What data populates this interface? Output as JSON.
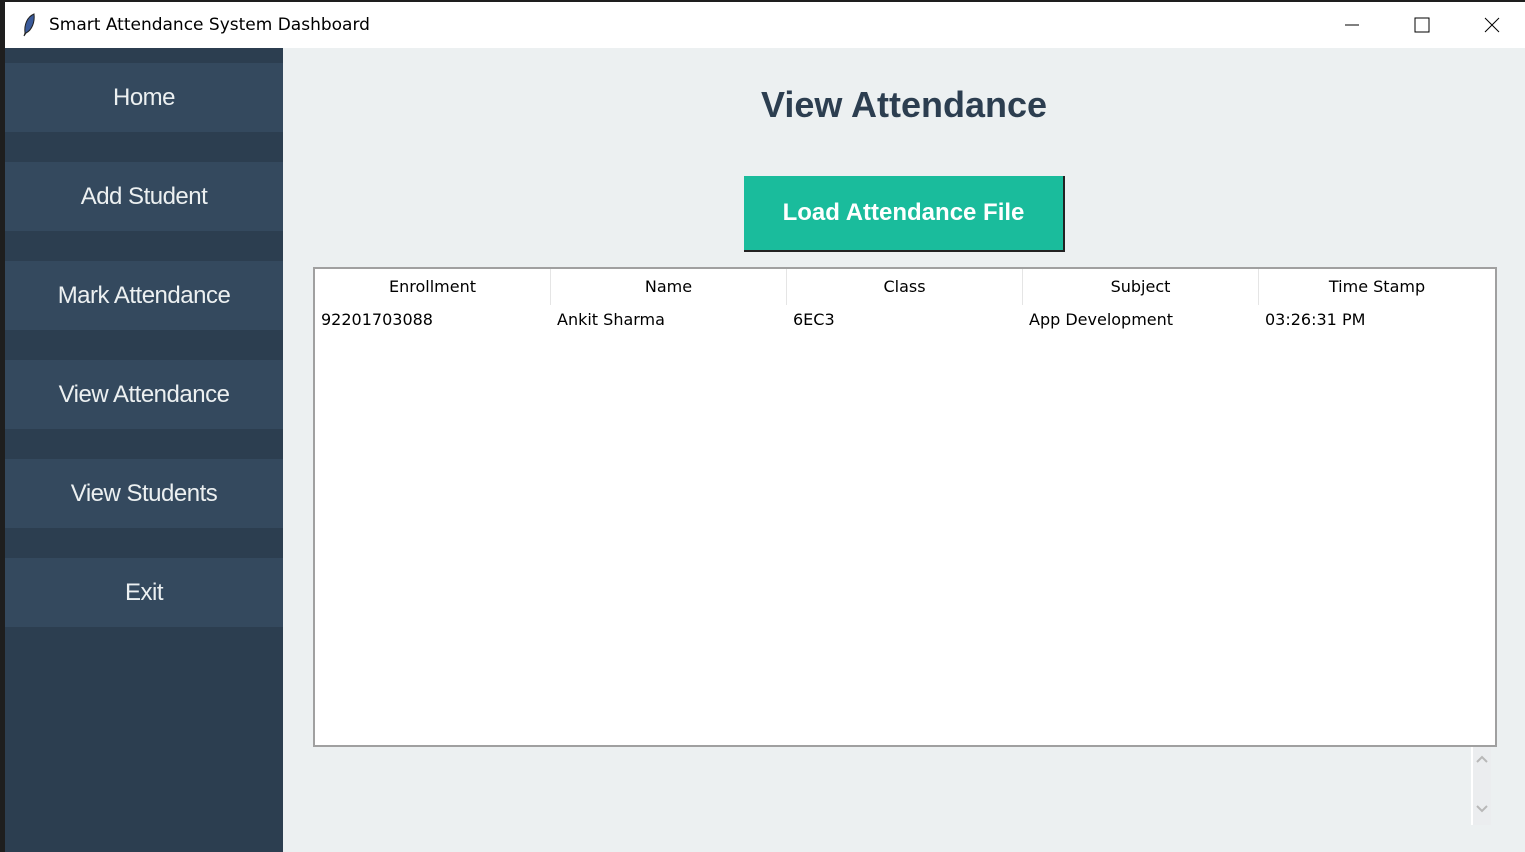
{
  "window": {
    "title": "Smart Attendance System Dashboard"
  },
  "sidebar": {
    "items": [
      {
        "label": "Home"
      },
      {
        "label": "Add Student"
      },
      {
        "label": "Mark Attendance"
      },
      {
        "label": "View Attendance"
      },
      {
        "label": "View Students"
      },
      {
        "label": "Exit"
      }
    ]
  },
  "main": {
    "heading": "View Attendance",
    "load_button": "Load Attendance File",
    "table": {
      "columns": [
        "Enrollment",
        "Name",
        "Class",
        "Subject",
        "Time Stamp"
      ],
      "rows": [
        [
          "92201703088",
          "Ankit Sharma",
          "6EC3",
          "App Development",
          "03:26:31 PM"
        ]
      ]
    }
  },
  "colors": {
    "sidebar": "#2c3e50",
    "nav_button": "#34495e",
    "accent": "#1abc9c",
    "background": "#ecf0f1"
  }
}
